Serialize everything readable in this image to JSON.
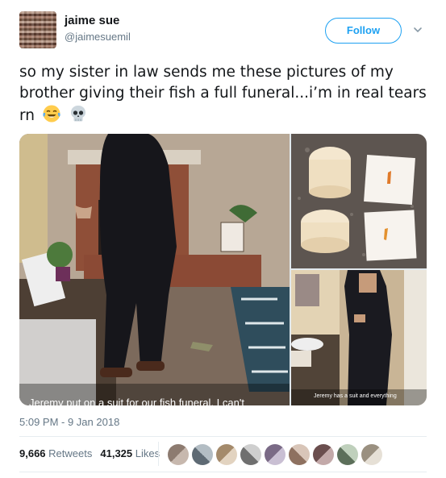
{
  "user": {
    "display_name": "jaime sue",
    "handle": "@jaimesuemil",
    "follow_label": "Follow"
  },
  "tweet": {
    "text": "so my sister in law sends me these pictures of my brother giving their fish a full funeral...i’m in real tears rn",
    "emojis": [
      "face-with-tears-of-joy",
      "skull"
    ]
  },
  "media": {
    "caption_left": "Jeremy put on a suit for our fish funeral. I can't",
    "caption_bottom_right": "Jeremy has a suit and everything"
  },
  "meta": {
    "timestamp": "5:09 PM - 9 Jan 2018"
  },
  "stats": {
    "retweets_count": "9,666",
    "retweets_label": "Retweets",
    "likes_count": "41,325",
    "likes_label": "Likes"
  },
  "colors": {
    "accent": "#1da1f2",
    "secondary_text": "#657786",
    "divider": "#e6ecf0"
  }
}
